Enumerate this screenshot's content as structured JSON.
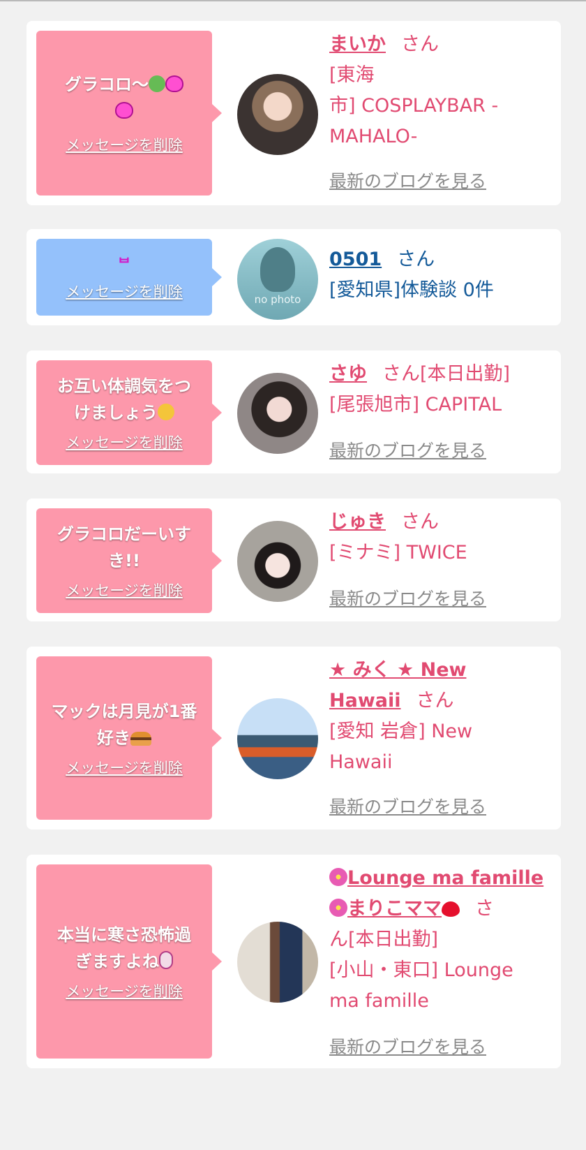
{
  "cards": [
    {
      "message": "グラコロ〜",
      "delete_label": "メッセージを削除",
      "name": "まいか",
      "san": "さん",
      "shop": "[東海市] COSPLAYBAR -MAHALO-",
      "shop_line1": "[東海",
      "shop_line2": "市] COSPLAYBAR -",
      "shop_line3": "MAHALO-",
      "blog_label": "最新のブログを見る"
    },
    {
      "message": "",
      "delete_label": "メッセージを削除",
      "name": "0501",
      "san": "さん",
      "avatar_text": "no photo",
      "shop": "[愛知県]体験談 0件"
    },
    {
      "message": "お互い体調気をつけましょう",
      "message_line1": "お互い体調気をつ",
      "message_line2": "けましょう",
      "delete_label": "メッセージを削除",
      "name": "さゆ",
      "san": "さん[本日出勤]",
      "shop": "[尾張旭市] CAPITAL",
      "blog_label": "最新のブログを見る"
    },
    {
      "message": "グラコロだーいすき!!",
      "message_line1": "グラコロだーいす",
      "message_line2": "き!!",
      "delete_label": "メッセージを削除",
      "name": "じゅき",
      "san": "さん",
      "shop": "[ミナミ] TWICE",
      "blog_label": "最新のブログを見る"
    },
    {
      "message": "マックは月見が1番好き",
      "message_line1": "マックは月見が1番",
      "message_line2": "好き",
      "delete_label": "メッセージを削除",
      "name_line1": "★ みく ★ New",
      "name_line2": "Hawaii",
      "san": "さん",
      "shop_line1": "[愛知 岩倉] New",
      "shop_line2": "Hawaii",
      "blog_label": "最新のブログを見る"
    },
    {
      "message": "本当に寒さ恐怖過ぎますよね",
      "message_line1": "本当に寒さ恐怖過",
      "message_line2": "ぎますよね",
      "delete_label": "メッセージを削除",
      "name_line1": "Lounge ma famille",
      "name_line2": "まりこママ",
      "san_line1": "さ",
      "san_line2": "ん[本日出勤]",
      "shop_line1": "[小山・東口] Lounge",
      "shop_line2": "ma famille",
      "blog_label": "最新のブログを見る"
    }
  ],
  "colors": {
    "pink_bubble": "#fd98ab",
    "blue_bubble": "#94c1fb",
    "pink_text": "#e14a71",
    "blue_text": "#145a99",
    "blog_link": "#8a8a8a"
  }
}
